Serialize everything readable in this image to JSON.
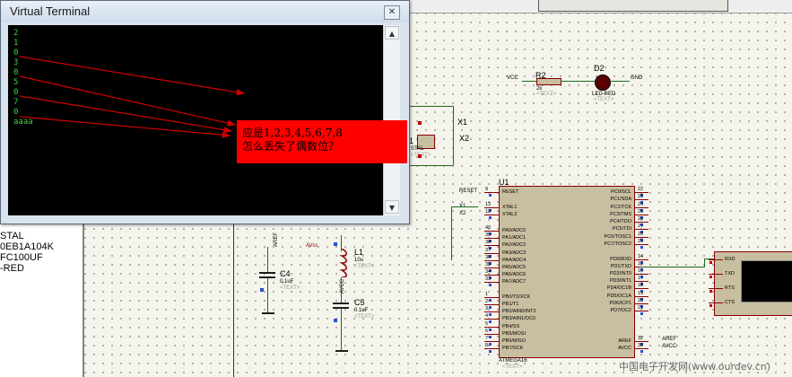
{
  "terminal": {
    "title": "Virtual Terminal",
    "close_icon_label": "✕",
    "lines": [
      "2",
      "1",
      "0",
      "3",
      "0",
      "5",
      "0",
      "7",
      "0",
      "aaaa"
    ]
  },
  "annotation": {
    "line1": "应是1,2,3,4,5,6,7,8",
    "line2": "怎么丢失了偶数位？",
    "color": "#ff0000"
  },
  "left_panel": {
    "items": [
      "STAL",
      "0EB1A104K",
      "FC100UF",
      "-RED"
    ]
  },
  "schematic": {
    "r2": {
      "name": "R2",
      "value": "2k",
      "text": "<TEXT>"
    },
    "d2": {
      "name": "D2",
      "value": "LED-RED",
      "text": "<TEXT>"
    },
    "vcc": "VCC",
    "gnd": "GND",
    "crystal": {
      "name": "1",
      "value": "STAL",
      "text": "<TEXT>",
      "x1": "X1",
      "x2": "X2"
    },
    "l1": {
      "name": "L1",
      "value": "10u",
      "text": "<TEXT>",
      "net": "AVCC"
    },
    "c4": {
      "name": "C4",
      "value": "0.1uF",
      "text": "<TEXT>"
    },
    "c5": {
      "name": "C5",
      "value": "0.1uF",
      "text": "<TEXT>"
    },
    "aref": "AREF",
    "vcc_small": "VCC",
    "mcu": {
      "name": "U1",
      "part": "ATMEGA16",
      "text": "<TEXT>",
      "left_pins": [
        {
          "num": "9",
          "label": "RESET",
          "net": "RESET"
        },
        {
          "num": "13",
          "label": "XTAL1",
          "net": "X1"
        },
        {
          "num": "12",
          "label": "XTAL2",
          "net": "X2"
        },
        {
          "num": "40",
          "label": "PA0/ADC0"
        },
        {
          "num": "39",
          "label": "PA1/ADC1"
        },
        {
          "num": "38",
          "label": "PA2/ADC2"
        },
        {
          "num": "37",
          "label": "PA3/ADC3"
        },
        {
          "num": "36",
          "label": "PA4/ADC4"
        },
        {
          "num": "35",
          "label": "PA5/ADC5"
        },
        {
          "num": "34",
          "label": "PA6/ADC6"
        },
        {
          "num": "33",
          "label": "PA7/ADC7"
        },
        {
          "num": "1",
          "label": "PB0/T0/XCK"
        },
        {
          "num": "2",
          "label": "PB1/T1"
        },
        {
          "num": "3",
          "label": "PB2/AIN0/INT2"
        },
        {
          "num": "4",
          "label": "PB3/AIN1/OC0"
        },
        {
          "num": "5",
          "label": "PB4/SS"
        },
        {
          "num": "6",
          "label": "PB5/MOSI"
        },
        {
          "num": "7",
          "label": "PB6/MISO"
        },
        {
          "num": "8",
          "label": "PB7/SCK"
        }
      ],
      "right_pins": [
        {
          "num": "22",
          "label": "PC0/SCL"
        },
        {
          "num": "23",
          "label": "PC1/SDA"
        },
        {
          "num": "24",
          "label": "PC2/TCK"
        },
        {
          "num": "25",
          "label": "PC3/TMS"
        },
        {
          "num": "26",
          "label": "PC4/TDO"
        },
        {
          "num": "27",
          "label": "PC5/TDI"
        },
        {
          "num": "28",
          "label": "PC6/TOSC1"
        },
        {
          "num": "29",
          "label": "PC7/TOSC2"
        },
        {
          "num": "14",
          "label": "PD0/RXD"
        },
        {
          "num": "15",
          "label": "PD1/TXD"
        },
        {
          "num": "16",
          "label": "PD2/INT0"
        },
        {
          "num": "17",
          "label": "PD3/INT1"
        },
        {
          "num": "18",
          "label": "PD4/OC1B"
        },
        {
          "num": "19",
          "label": "PD5/OC1A"
        },
        {
          "num": "20",
          "label": "PD6/ICP1"
        },
        {
          "num": "21",
          "label": "PD7/OC2"
        },
        {
          "num": "32",
          "label": "AREF",
          "net": "AREF"
        },
        {
          "num": "30",
          "label": "AVCC",
          "net": "AVCC"
        }
      ]
    },
    "vt2_pins": [
      "RXD",
      "TXD",
      "RTS",
      "CTS"
    ]
  },
  "watermark": "中国电子开发网(www.ourdev.cn)"
}
